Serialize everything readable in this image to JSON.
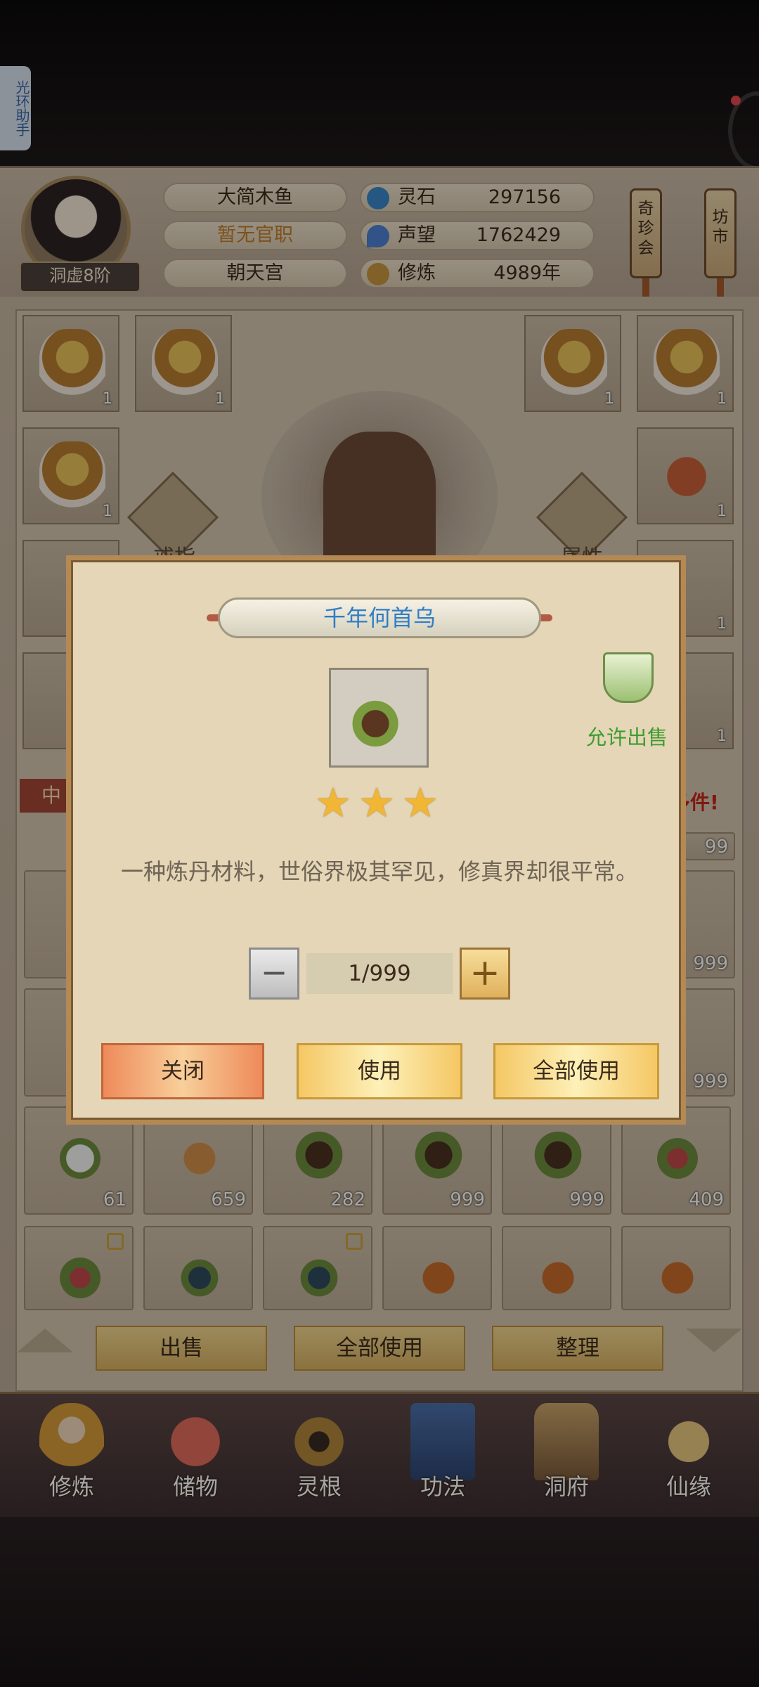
{
  "helper": {
    "label": "光环助手"
  },
  "player": {
    "name": "大简木鱼",
    "official_title": "暂无官职",
    "sect": "朝天宫",
    "realm": "洞虚8阶"
  },
  "stats": [
    {
      "label": "灵石",
      "value": "297156",
      "icon": "spirit-stone-icon",
      "color": "#3b86c8"
    },
    {
      "label": "声望",
      "value": "1762429",
      "icon": "prestige-icon",
      "color": "#4c80d0"
    },
    {
      "label": "修炼",
      "value": "4989年",
      "icon": "meditation-icon",
      "color": "#c7953c"
    }
  ],
  "shops": [
    {
      "label": "奇珍会"
    },
    {
      "label": "坊市"
    }
  ],
  "equipment": {
    "ring_label": "戒指",
    "attribute_label": "属性",
    "slot_count": "1"
  },
  "category_tag": "中",
  "more_items_text": "多件!",
  "bag": {
    "row_counts_visible": [
      "99",
      "999",
      "999"
    ],
    "herb_row": [
      "61",
      "659",
      "282",
      "999",
      "999",
      "409"
    ]
  },
  "actions": {
    "sell": "出售",
    "use_all": "全部使用",
    "sort": "整理"
  },
  "nav": [
    {
      "label": "修炼"
    },
    {
      "label": "储物"
    },
    {
      "label": "灵根"
    },
    {
      "label": "功法"
    },
    {
      "label": "洞府"
    },
    {
      "label": "仙缘"
    }
  ],
  "modal": {
    "item_name": "千年何首乌",
    "stars": 3,
    "allow_sale": "允许出售",
    "description": "一种炼丹材料，世俗界极其罕见，修真界却很平常。",
    "quantity": "1/999",
    "minus": "−",
    "plus": "+",
    "close": "关闭",
    "use": "使用",
    "use_all": "全部使用"
  }
}
